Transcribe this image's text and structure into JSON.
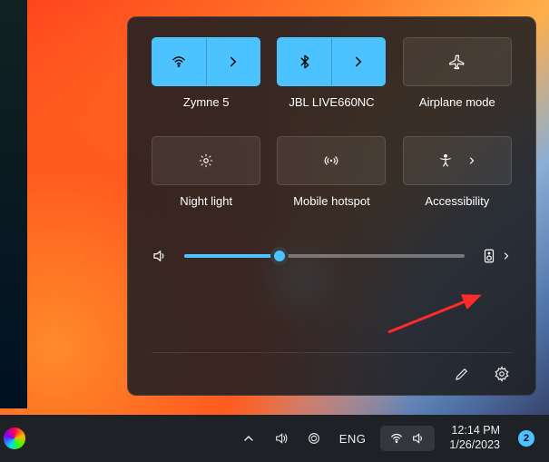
{
  "quick": {
    "tiles": [
      {
        "label": "Zymne 5",
        "icon": "wifi-icon",
        "active": true,
        "split": true
      },
      {
        "label": "JBL LIVE660NC",
        "icon": "bluetooth-icon",
        "active": true,
        "split": true
      },
      {
        "label": "Airplane mode",
        "icon": "airplane-icon",
        "active": false,
        "split": false
      },
      {
        "label": "Night light",
        "icon": "night-light-icon",
        "active": false,
        "split": false
      },
      {
        "label": "Mobile hotspot",
        "icon": "hotspot-icon",
        "active": false,
        "split": false
      },
      {
        "label": "Accessibility",
        "icon": "accessibility-icon",
        "active": false,
        "split": true
      }
    ],
    "volume_percent": 34
  },
  "taskbar": {
    "language": "ENG",
    "time": "12:14 PM",
    "date": "1/26/2023",
    "notification_count": "2"
  }
}
